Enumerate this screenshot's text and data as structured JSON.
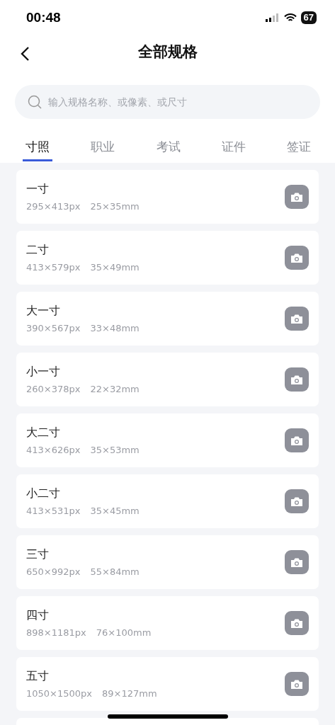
{
  "status_bar": {
    "time": "00:48",
    "battery": "67"
  },
  "nav": {
    "title": "全部规格"
  },
  "search": {
    "placeholder": "输入规格名称、或像素、或尺寸"
  },
  "tabs": [
    {
      "label": "寸照",
      "selected": true
    },
    {
      "label": "职业",
      "selected": false
    },
    {
      "label": "考试",
      "selected": false
    },
    {
      "label": "证件",
      "selected": false
    },
    {
      "label": "签证",
      "selected": false
    }
  ],
  "specs": [
    {
      "name": "一寸",
      "pixels": "295×413px",
      "size": "25×35mm"
    },
    {
      "name": "二寸",
      "pixels": "413×579px",
      "size": "35×49mm"
    },
    {
      "name": "大一寸",
      "pixels": "390×567px",
      "size": "33×48mm"
    },
    {
      "name": "小一寸",
      "pixels": "260×378px",
      "size": "22×32mm"
    },
    {
      "name": "大二寸",
      "pixels": "413×626px",
      "size": "35×53mm"
    },
    {
      "name": "小二寸",
      "pixels": "413×531px",
      "size": "35×45mm"
    },
    {
      "name": "三寸",
      "pixels": "650×992px",
      "size": "55×84mm"
    },
    {
      "name": "四寸",
      "pixels": "898×1181px",
      "size": "76×100mm"
    },
    {
      "name": "五寸",
      "pixels": "1050×1500px",
      "size": "89×127mm"
    }
  ]
}
